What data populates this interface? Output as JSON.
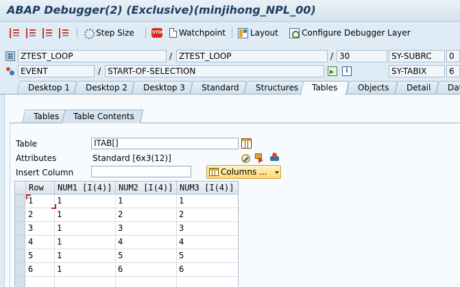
{
  "window": {
    "title": "ABAP Debugger(2)  (Exclusive)(minjihong_NPL_00)"
  },
  "toolbar": {
    "step_icons": [
      "single-step-icon",
      "execute-icon",
      "return-icon",
      "continue-icon"
    ],
    "step_size_label": "Step Size",
    "stop_icon_text": "STOP",
    "watchpoint_label": "Watchpoint",
    "layout_label": "Layout",
    "configure_label": "Configure Debugger Layer"
  },
  "info": {
    "program": "ZTEST_LOOP",
    "include": "ZTEST_LOOP",
    "line": "30",
    "subrc_label": "SY-SUBRC",
    "subrc_value": "0",
    "event_type": "EVENT",
    "event_name": "START-OF-SELECTION",
    "tabix_label": "SY-TABIX",
    "tabix_value": "6",
    "separator": "/"
  },
  "main_tabs": [
    {
      "label": "Desktop 1",
      "active": false
    },
    {
      "label": "Desktop 2",
      "active": false
    },
    {
      "label": "Desktop 3",
      "active": false
    },
    {
      "label": "Standard",
      "active": false
    },
    {
      "label": "Structures",
      "active": false
    },
    {
      "label": "Tables",
      "active": true
    },
    {
      "label": "Objects",
      "active": false
    },
    {
      "label": "Detail",
      "active": false
    },
    {
      "label": "Data",
      "active": false
    }
  ],
  "sub_tabs": [
    {
      "label": "Tables",
      "active": false
    },
    {
      "label": "Table Contents",
      "active": true
    }
  ],
  "form": {
    "table_label": "Table",
    "table_value": "ITAB[]",
    "attributes_label": "Attributes",
    "attributes_value": "Standard [6x3(12)]",
    "insert_column_label": "Insert Column",
    "insert_column_value": "",
    "columns_button": "Columns ..."
  },
  "grid": {
    "columns": [
      "Row",
      "NUM1 [I(4)]",
      "NUM2 [I(4)]",
      "NUM3 [I(4)]"
    ],
    "rows": [
      [
        "1",
        "1",
        "1",
        "1"
      ],
      [
        "2",
        "1",
        "2",
        "2"
      ],
      [
        "3",
        "1",
        "3",
        "3"
      ],
      [
        "4",
        "1",
        "4",
        "4"
      ],
      [
        "5",
        "1",
        "5",
        "5"
      ],
      [
        "6",
        "1",
        "6",
        "6"
      ]
    ]
  },
  "colors": {
    "title": "#1e3d5c",
    "background": "#dfebf5",
    "panel": "#f7fbfe",
    "columns_button": "#ffd96a"
  }
}
